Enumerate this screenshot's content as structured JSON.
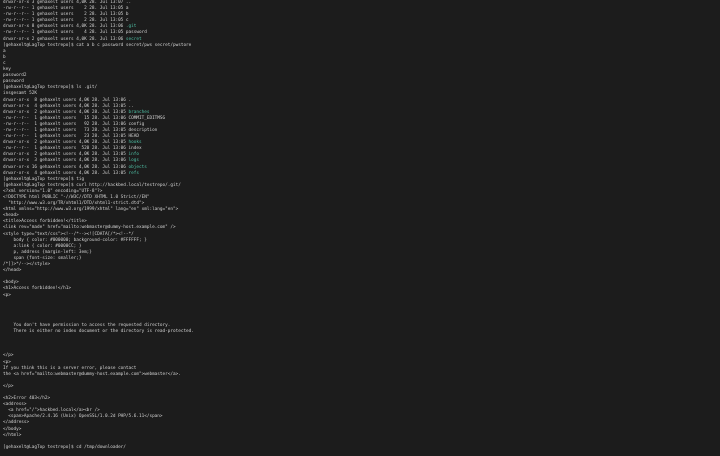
{
  "terminal": {
    "colors": {
      "background": "#1c1c1c",
      "text": "#d4d4d4",
      "directory": "#4fc1a6"
    },
    "lines": [
      {
        "text": "drwxr-xr-x 3 gehaxelt users 4,0K 28. Jul 13:07 ..",
        "hl": ""
      },
      {
        "text": "-rw-r--r-- 1 gehaxelt users    2 28. Jul 13:05 a",
        "hl": ""
      },
      {
        "text": "-rw-r--r-- 1 gehaxelt users    2 28. Jul 13:05 b",
        "hl": ""
      },
      {
        "text": "-rw-r--r-- 1 gehaxelt users    2 28. Jul 13:05 c",
        "hl": ""
      },
      {
        "text": "drwxr-xr-x 8 gehaxelt users 4,0K 28. Jul 13:06 ",
        "hl": ".git"
      },
      {
        "text": "-rw-r--r-- 1 gehaxelt users    4 28. Jul 13:05 password",
        "hl": ""
      },
      {
        "text": "drwxr-xr-x 2 gehaxelt users 4,0K 28. Jul 13:06 ",
        "hl": "secret"
      },
      {
        "text": "[gehaxelt@LagTop testrepo]$ cat a b c password secret/pws secret/pwstore",
        "hl": ""
      },
      {
        "text": "a",
        "hl": ""
      },
      {
        "text": "b",
        "hl": ""
      },
      {
        "text": "c",
        "hl": ""
      },
      {
        "text": "key",
        "hl": ""
      },
      {
        "text": "password2",
        "hl": ""
      },
      {
        "text": "password",
        "hl": ""
      },
      {
        "text": "[gehaxelt@LagTop testrepo]$ ls .git/",
        "hl": ""
      },
      {
        "text": "insgesamt 52K",
        "hl": ""
      },
      {
        "text": "drwxr-xr-x  8 gehaxelt users 4,0K 28. Jul 13:06 .",
        "hl": ""
      },
      {
        "text": "drwxr-xr-x  4 gehaxelt users 4,0K 28. Jul 13:05 ..",
        "hl": ""
      },
      {
        "text": "drwxr-xr-x  2 gehaxelt users 4,0K 28. Jul 13:05 ",
        "hl": "branches"
      },
      {
        "text": "-rw-r--r--  1 gehaxelt users   15 28. Jul 13:06 COMMIT_EDITMSG",
        "hl": ""
      },
      {
        "text": "-rw-r--r--  1 gehaxelt users   92 28. Jul 13:06 config",
        "hl": ""
      },
      {
        "text": "-rw-r--r--  1 gehaxelt users   73 28. Jul 13:05 description",
        "hl": ""
      },
      {
        "text": "-rw-r--r--  1 gehaxelt users   23 28. Jul 13:05 HEAD",
        "hl": ""
      },
      {
        "text": "drwxr-xr-x  2 gehaxelt users 4,0K 28. Jul 13:05 ",
        "hl": "hooks"
      },
      {
        "text": "-rw-r--r--  1 gehaxelt users  520 28. Jul 13:06 index",
        "hl": ""
      },
      {
        "text": "drwxr-xr-x  2 gehaxelt users 4,0K 28. Jul 13:05 ",
        "hl": "info"
      },
      {
        "text": "drwxr-xr-x  3 gehaxelt users 4,0K 28. Jul 13:06 ",
        "hl": "logs"
      },
      {
        "text": "drwxr-xr-x 16 gehaxelt users 4,0K 28. Jul 13:06 ",
        "hl": "objects"
      },
      {
        "text": "drwxr-xr-x  4 gehaxelt users 4,0K 28. Jul 13:05 ",
        "hl": "refs"
      },
      {
        "text": "[gehaxelt@LagTop testrepo]$ tig",
        "hl": ""
      },
      {
        "text": "[gehaxelt@LagTop testrepo]$ curl http://hackbed.local/testrepo/.git/",
        "hl": ""
      },
      {
        "text": "<?xml version=\"1.0\" encoding=\"UTF-8\"?>",
        "hl": ""
      },
      {
        "text": "<!DOCTYPE html PUBLIC \"-//W3C//DTD XHTML 1.0 Strict//EN\"",
        "hl": ""
      },
      {
        "text": "  \"http://www.w3.org/TR/xhtml1/DTD/xhtml1-strict.dtd\">",
        "hl": ""
      },
      {
        "text": "<html xmlns=\"http://www.w3.org/1999/xhtml\" lang=\"en\" xml:lang=\"en\">",
        "hl": ""
      },
      {
        "text": "<head>",
        "hl": ""
      },
      {
        "text": "<title>Access forbidden!</title>",
        "hl": ""
      },
      {
        "text": "<link rev=\"made\" href=\"mailto:webmaster@dummy-host.example.com\" />",
        "hl": ""
      },
      {
        "text": "<style type=\"text/css\"><!--/*--><![CDATA[/*><!--*/",
        "hl": ""
      },
      {
        "text": "    body { color: #000000; background-color: #FFFFFF; }",
        "hl": ""
      },
      {
        "text": "    a:link { color: #0000CC; }",
        "hl": ""
      },
      {
        "text": "    p, address {margin-left: 3em;}",
        "hl": ""
      },
      {
        "text": "    span {font-size: smaller;}",
        "hl": ""
      },
      {
        "text": "/*]]>*/--></style>",
        "hl": ""
      },
      {
        "text": "</head>",
        "hl": ""
      },
      {
        "text": "",
        "hl": ""
      },
      {
        "text": "<body>",
        "hl": ""
      },
      {
        "text": "<h1>Access forbidden!</h1>",
        "hl": ""
      },
      {
        "text": "<p>",
        "hl": ""
      },
      {
        "text": "",
        "hl": ""
      },
      {
        "text": "",
        "hl": ""
      },
      {
        "text": "",
        "hl": ""
      },
      {
        "text": "",
        "hl": ""
      },
      {
        "text": "    You don't have permission to access the requested directory.",
        "hl": ""
      },
      {
        "text": "    There is either no index document or the directory is read-protected.",
        "hl": ""
      },
      {
        "text": "",
        "hl": ""
      },
      {
        "text": "",
        "hl": ""
      },
      {
        "text": "",
        "hl": ""
      },
      {
        "text": "</p>",
        "hl": ""
      },
      {
        "text": "<p>",
        "hl": ""
      },
      {
        "text": "If you think this is a server error, please contact",
        "hl": ""
      },
      {
        "text": "the <a href=\"mailto:webmaster@dummy-host.example.com\">webmaster</a>.",
        "hl": ""
      },
      {
        "text": "",
        "hl": ""
      },
      {
        "text": "</p>",
        "hl": ""
      },
      {
        "text": "",
        "hl": ""
      },
      {
        "text": "<h2>Error 403</h2>",
        "hl": ""
      },
      {
        "text": "<address>",
        "hl": ""
      },
      {
        "text": "  <a href=\"/\">hackbed.local</a><br />",
        "hl": ""
      },
      {
        "text": "  <span>Apache/2.4.16 (Unix) OpenSSL/1.0.2d PHP/5.6.11</span>",
        "hl": ""
      },
      {
        "text": "</address>",
        "hl": ""
      },
      {
        "text": "</body>",
        "hl": ""
      },
      {
        "text": "</html>",
        "hl": ""
      },
      {
        "text": "",
        "hl": ""
      },
      {
        "text": "[gehaxelt@LagTop testrepo]$ cd /tmp/downloader/",
        "hl": ""
      }
    ]
  }
}
